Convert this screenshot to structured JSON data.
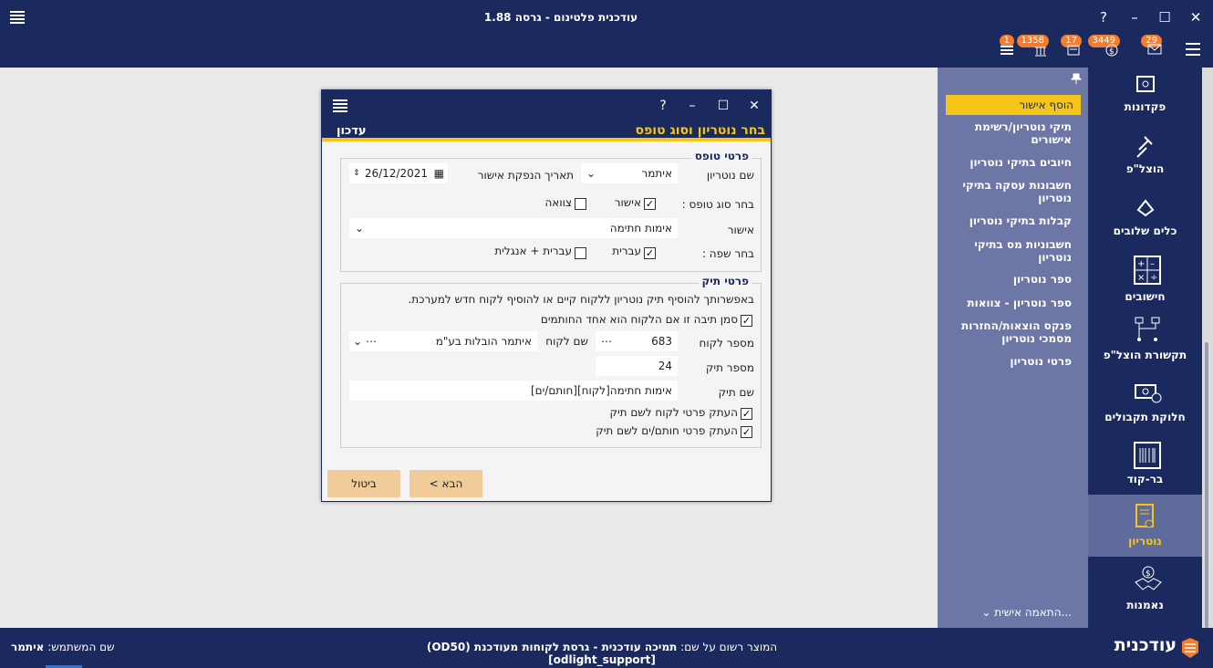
{
  "app": {
    "title": "עודכנית פלטינום - גרסה 1.88"
  },
  "notifications": [
    {
      "count": "29",
      "icon": "mail-icon"
    },
    {
      "count": "3449",
      "icon": "payment-icon"
    },
    {
      "count": "17",
      "icon": "document-icon"
    },
    {
      "count": "1358",
      "icon": "court-icon"
    },
    {
      "count": "1",
      "icon": "stack-icon"
    }
  ],
  "nav": [
    {
      "label": "פקדונות",
      "icon": "deposit-icon"
    },
    {
      "label": "הוצל\"פ",
      "icon": "gavel-icon"
    },
    {
      "label": "כלים שלובים",
      "icon": "tools-icon"
    },
    {
      "label": "חישובים",
      "icon": "calculator-icon"
    },
    {
      "label": "תקשורת הוצל\"פ",
      "icon": "network-icon"
    },
    {
      "label": "חלוקת תקבולים",
      "icon": "money-icon"
    },
    {
      "label": "בר-קוד",
      "icon": "barcode-icon"
    },
    {
      "label": "נוטריון",
      "icon": "certificate-icon"
    },
    {
      "label": "נאמנות",
      "icon": "handshake-icon"
    }
  ],
  "subnav": {
    "items": [
      "הוסף אישור",
      "תיקי נוטריון/רשימת אישורים",
      "חיובים בתיקי נוטריון",
      "חשבונות עסקה בתיקי נוטריון",
      "קבלות בתיקי נוטריון",
      "חשבוניות מס בתיקי נוטריון",
      "ספר נוטריון",
      "ספר נוטריון - צוואות",
      "פנקס הוצאות/החזרות מסמכי נוטריון",
      "פרטי נוטריון"
    ],
    "customize": "התאמה אישית..."
  },
  "footer": {
    "user_label": "שם המשתמש:",
    "user_name": "איתמר",
    "registered_label": "המוצר רשום על שם:",
    "registered_value": "תמיכה עודכנית - גרסת לקוחות מעודכנת (OD50) [odlight_support]",
    "brand": "עודכנית"
  },
  "dialog": {
    "title": "בחר נוטריון וסוג טופס",
    "app_name": "עדכון",
    "form_group": {
      "legend": "פרטי טופס",
      "notary_label": "שם נוטריון",
      "notary_value": "איתמר",
      "date_label": "תאריך הנפקת אישור",
      "date_value": "26/12/2021",
      "form_type_label": "בחר סוג טופס :",
      "opt_approval": "אישור",
      "opt_will": "צוואה",
      "approval_label": "אישור",
      "approval_value": "אימות חתימה",
      "language_label": "בחר שפה :",
      "opt_hebrew": "עברית",
      "opt_heb_eng": "עברית + אנגלית"
    },
    "file_group": {
      "legend": "פרטי תיק",
      "info": "באפשרותך להוסיף תיק נוטריון ללקוח קיים או להוסיף לקוח חדש למערכת.",
      "client_signer": "סמן תיבה זו אם הלקוח הוא אחד החותמים",
      "client_no_label": "מספר לקוח",
      "client_no_value": "683",
      "client_name_label": "שם לקוח",
      "client_name_value": "איתמר הובלות בע\"מ",
      "file_no_label": "מספר תיק",
      "file_no_value": "24",
      "file_name_label": "שם תיק",
      "file_name_value": "אימות חתימה[לקוח][חותם/ים]",
      "copy_client": "העתק פרטי לקוח לשם תיק",
      "copy_signers": "העתק פרטי חותם/ים לשם תיק"
    },
    "next_button": "הבא >",
    "cancel_button": "ביטול"
  },
  "colors": {
    "navy": "#1b2a5e",
    "accent": "#f5c518",
    "badge": "#f57c2a",
    "subpanel": "#6c77a6"
  }
}
